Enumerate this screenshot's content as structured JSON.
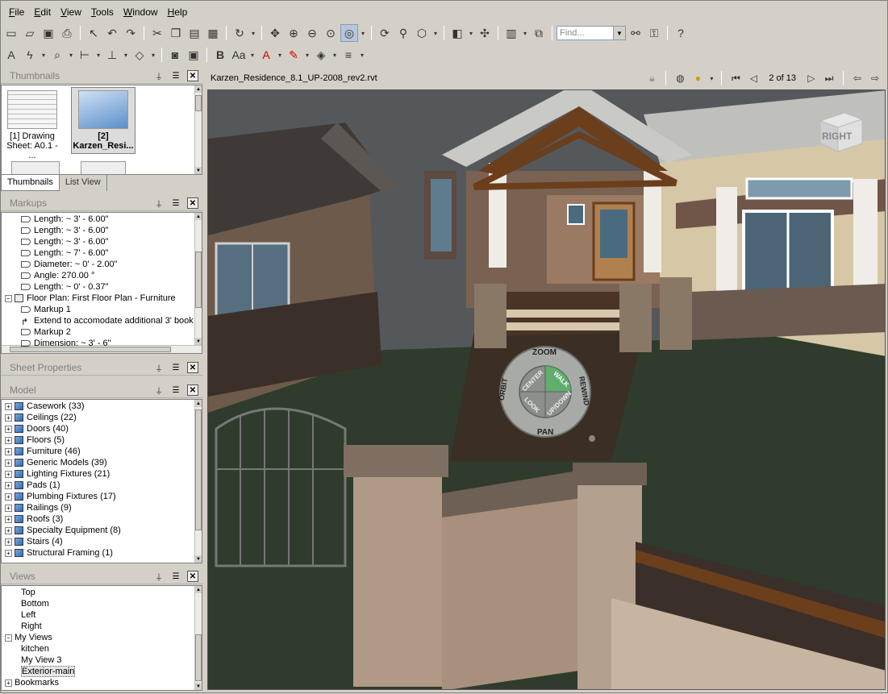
{
  "menu": [
    {
      "key": "F",
      "rest": "ile"
    },
    {
      "key": "E",
      "rest": "dit"
    },
    {
      "key": "V",
      "rest": "iew"
    },
    {
      "key": "T",
      "rest": "ools"
    },
    {
      "key": "W",
      "rest": "indow"
    },
    {
      "key": "H",
      "rest": "elp"
    }
  ],
  "toolbar": {
    "find_placeholder": "Find..."
  },
  "thumbnails": {
    "title": "Thumbnails",
    "items": [
      {
        "line1": "[1] Drawing",
        "line2": "Sheet: A0.1 - ..."
      },
      {
        "line1": "[2]",
        "line2": "Karzen_Resi..."
      }
    ],
    "tabs": [
      "Thumbnails",
      "List View"
    ]
  },
  "markups": {
    "title": "Markups",
    "rows": [
      {
        "text": "Length: ~ 3' - 6.00\"",
        "indent": 2,
        "icon": "arrow"
      },
      {
        "text": "Length: ~ 3' - 6.00\"",
        "indent": 2,
        "icon": "arrow"
      },
      {
        "text": "Length: ~ 3' - 6.00\"",
        "indent": 2,
        "icon": "arrow"
      },
      {
        "text": "Length: ~ 7' - 6.00\"",
        "indent": 2,
        "icon": "arrow"
      },
      {
        "text": "Diameter: ~ 0' - 2.00\"",
        "indent": 2,
        "icon": "arrow"
      },
      {
        "text": "Angle: 270.00 °",
        "indent": 2,
        "icon": "arrow"
      },
      {
        "text": "Length: ~ 0' - 0.37\"",
        "indent": 2,
        "icon": "arrow"
      },
      {
        "text": "Floor Plan: First Floor Plan - Furniture",
        "indent": 0,
        "icon": "plan",
        "exp": "−"
      },
      {
        "text": "Markup 1",
        "indent": 2,
        "icon": "arrow"
      },
      {
        "text": "Extend to accomodate additional 3' book",
        "indent": 2,
        "icon": "curve"
      },
      {
        "text": "Markup 2",
        "indent": 2,
        "icon": "arrow"
      },
      {
        "text": "Dimension: ~ 3' - 6\"",
        "indent": 2,
        "icon": "arrow"
      }
    ]
  },
  "sheet_properties": {
    "title": "Sheet Properties"
  },
  "model": {
    "title": "Model",
    "rows": [
      "Casework (33)",
      "Ceilings (22)",
      "Doors (40)",
      "Floors (5)",
      "Furniture (46)",
      "Generic Models (39)",
      "Lighting Fixtures (21)",
      "Pads (1)",
      "Plumbing Fixtures (17)",
      "Railings (9)",
      "Roofs (3)",
      "Specialty Equipment (8)",
      "Stairs (4)",
      "Structural Framing (1)"
    ]
  },
  "views": {
    "title": "Views",
    "rows": [
      {
        "text": "Top",
        "indent": 2
      },
      {
        "text": "Bottom",
        "indent": 2
      },
      {
        "text": "Left",
        "indent": 2
      },
      {
        "text": "Right",
        "indent": 2
      },
      {
        "text": "My Views",
        "indent": 0,
        "exp": "−"
      },
      {
        "text": "kitchen",
        "indent": 2
      },
      {
        "text": "My View 3",
        "indent": 2
      },
      {
        "text": "Exterior-main",
        "indent": 2,
        "selected": true
      },
      {
        "text": "Bookmarks",
        "indent": 0,
        "exp": "+"
      }
    ]
  },
  "document": {
    "filename": "Karzen_Residence_8.1_UP-2008_rev2.rvt",
    "page_indicator": "2 of 13"
  },
  "viewcube": {
    "face_label": "RIGHT"
  },
  "steering_wheel": {
    "labels": [
      "ZOOM",
      "REWIND",
      "PAN",
      "ORBIT",
      "CENTER",
      "WALK",
      "LOOK",
      "UP/DOWN"
    ],
    "highlight_color": "#5fae6e"
  },
  "colors": {
    "chrome": "#d4d0c8",
    "sky": "#5e6266",
    "grass": "#2e3c2c",
    "wall_beige": "#d9c7a4",
    "wall_brown": "#6e5346",
    "timber": "#6b3e1c",
    "roof": "#3b3b38"
  }
}
